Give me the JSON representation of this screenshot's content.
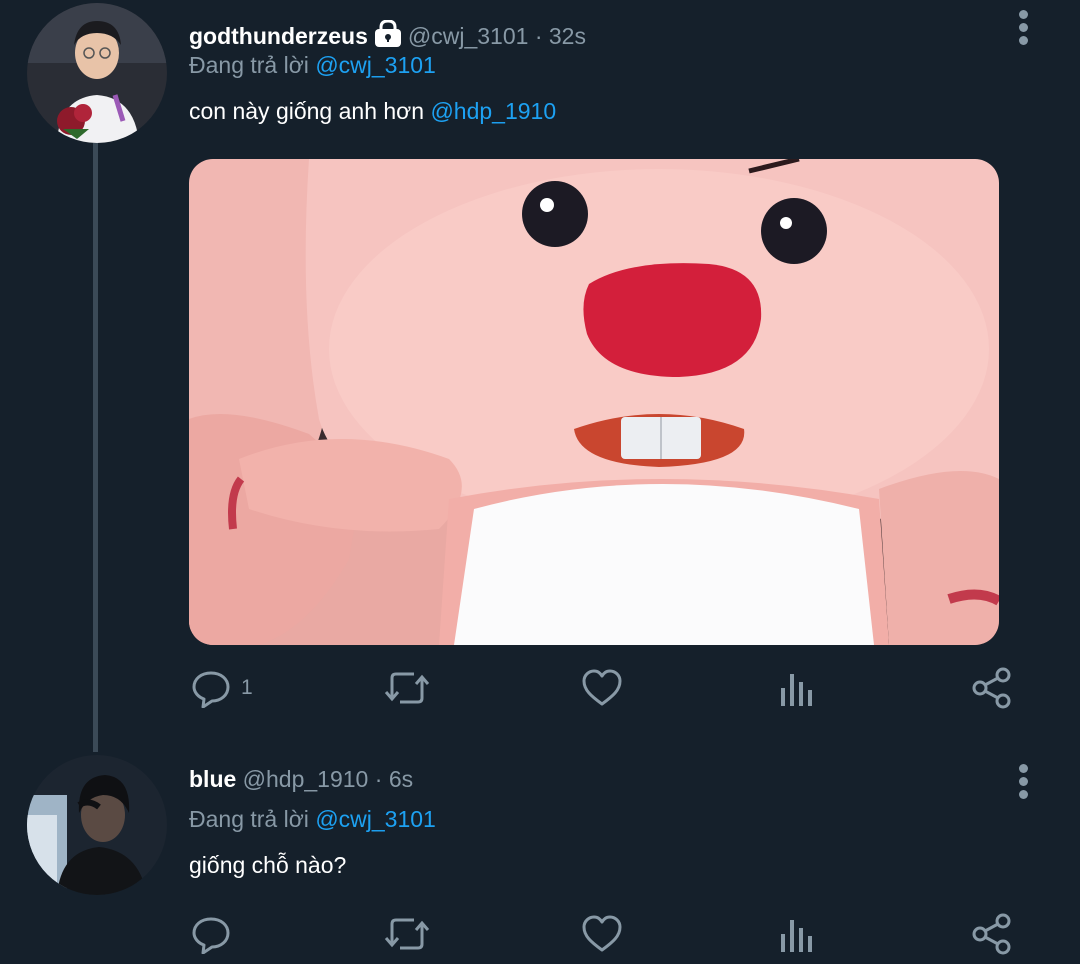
{
  "tweets": [
    {
      "display_name": "godthunderzeus",
      "handle": "@cwj_3101",
      "separator": "·",
      "time": "32s",
      "replying_prefix": "Đang trả lời",
      "replying_to": "@cwj_3101",
      "text": "con này giống anh hơn",
      "text_mention": "@hdp_1910",
      "reply_count": "1",
      "locked": true
    },
    {
      "display_name": "blue",
      "handle": "@hdp_1910",
      "separator": "·",
      "time": "6s",
      "replying_prefix": "Đang trả lời",
      "replying_to": "@cwj_3101",
      "text": "giống chỗ nào?",
      "reply_count": ""
    }
  ],
  "icons": {
    "lock": "lock-icon",
    "more": "more-vertical-icon",
    "reply": "reply-icon",
    "retweet": "retweet-icon",
    "like": "heart-icon",
    "analytics": "analytics-icon",
    "share": "share-icon"
  },
  "colors": {
    "background": "#15202b",
    "text": "#ffffff",
    "muted": "#8899a6",
    "accent": "#1da1f2",
    "thread_line": "#3b4a57"
  }
}
